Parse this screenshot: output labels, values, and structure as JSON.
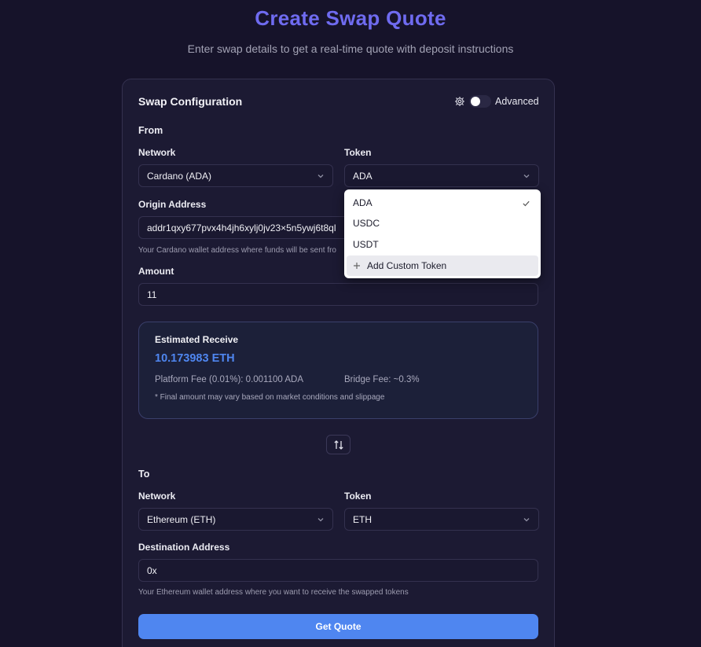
{
  "header": {
    "title": "Create Swap Quote",
    "subtitle": "Enter swap details to get a real-time quote with deposit instructions"
  },
  "card": {
    "title": "Swap Configuration",
    "advanced_label": "Advanced",
    "advanced_enabled": false
  },
  "from": {
    "section_label": "From",
    "network_label": "Network",
    "network_value": "Cardano (ADA)",
    "token_label": "Token",
    "token_value": "ADA",
    "origin_label": "Origin Address",
    "origin_value": "addr1qxy677pvx4h4jh6xylj0jv23×5n5ywj6t8ql",
    "origin_helper": "Your Cardano wallet address where funds will be sent fro",
    "amount_label": "Amount",
    "amount_value": "11"
  },
  "token_dropdown": {
    "options": [
      "ADA",
      "USDC",
      "USDT"
    ],
    "selected": "ADA",
    "add_custom_label": "Add Custom Token"
  },
  "estimate": {
    "title": "Estimated Receive",
    "value": "10.173983 ETH",
    "platform_fee": "Platform Fee (0.01%): 0.001100 ADA",
    "bridge_fee": "Bridge Fee: ~0.3%",
    "note": "* Final amount may vary based on market conditions and slippage"
  },
  "to": {
    "section_label": "To",
    "network_label": "Network",
    "network_value": "Ethereum (ETH)",
    "token_label": "Token",
    "token_value": "ETH",
    "destination_label": "Destination Address",
    "destination_value": "0x",
    "destination_helper": "Your Ethereum wallet address where you want to receive the swapped tokens"
  },
  "actions": {
    "get_quote_label": "Get Quote"
  },
  "colors": {
    "background": "#16132a",
    "title_accent": "#6f6bf0",
    "primary": "#4f86f0"
  },
  "icons": {
    "settings": "gear-icon",
    "select_chevron": "chevron-down-icon",
    "swap": "swap-vertical-icon",
    "selected": "check-icon",
    "add": "plus-icon"
  }
}
